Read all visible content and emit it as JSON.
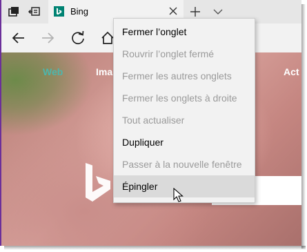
{
  "tab": {
    "title": "Bing",
    "favicon_color": "#008373"
  },
  "bing": {
    "nav": [
      "Web",
      "Ima",
      "Act"
    ],
    "accent": "#4db6ac"
  },
  "context_menu": {
    "items": [
      {
        "label": "Fermer l’onglet",
        "enabled": true
      },
      {
        "label": "Rouvrir l’onglet fermé",
        "enabled": false
      },
      {
        "label": "Fermer les autres onglets",
        "enabled": false
      },
      {
        "label": "Fermer les onglets à droite",
        "enabled": false
      },
      {
        "label": "Tout actualiser",
        "enabled": false
      },
      {
        "label": "Dupliquer",
        "enabled": true
      },
      {
        "label": "Passer à la nouvelle fenêtre",
        "enabled": false
      },
      {
        "label": "Épingler",
        "enabled": true,
        "hovered": true
      }
    ]
  },
  "icons": {
    "tabstrip": [
      "tab-manager-icon",
      "set-aside-tabs-icon"
    ],
    "nav": [
      "back-arrow-icon",
      "forward-arrow-icon",
      "refresh-icon",
      "home-icon"
    ],
    "tab": [
      "bing-favicon-icon",
      "close-icon"
    ],
    "newtab": "plus-icon",
    "tablist": "chevron-down-icon",
    "cursor": "mouse-cursor-icon"
  }
}
